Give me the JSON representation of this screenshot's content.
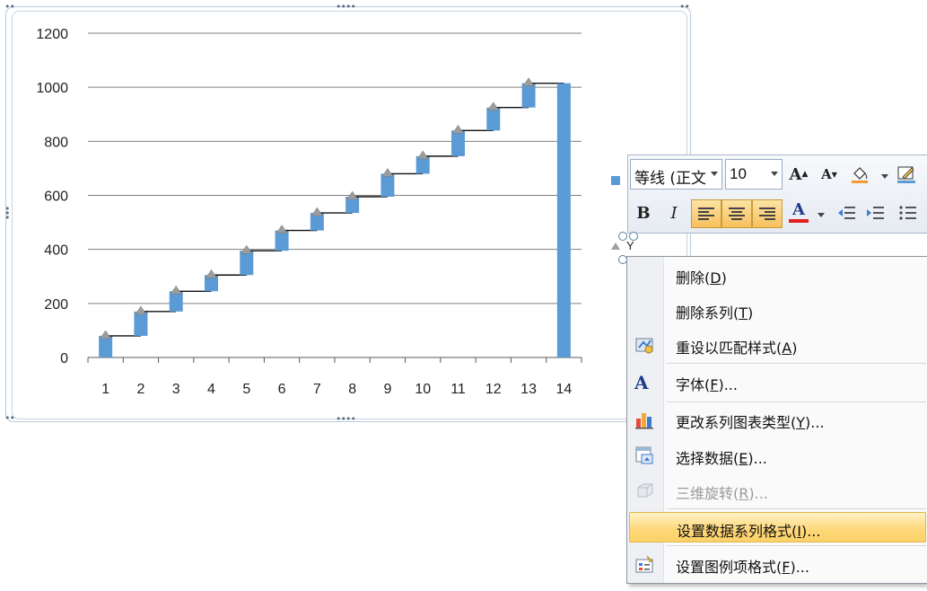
{
  "chart_data": {
    "type": "bar",
    "chart_style": "waterfall-step",
    "categories": [
      "1",
      "2",
      "3",
      "4",
      "5",
      "6",
      "7",
      "8",
      "9",
      "10",
      "11",
      "12",
      "13",
      "14"
    ],
    "series": [
      {
        "values": [
          80,
          170,
          245,
          305,
          395,
          470,
          535,
          595,
          680,
          745,
          840,
          925,
          1015,
          1015
        ],
        "color": "#5b9bd5"
      }
    ],
    "base_values": [
      0,
      80,
      170,
      245,
      305,
      395,
      470,
      535,
      595,
      680,
      745,
      840,
      925,
      0
    ],
    "ylim": [
      0,
      1200
    ],
    "yticks": [
      "0",
      "200",
      "400",
      "600",
      "800",
      "1000",
      "1200"
    ],
    "grid": true,
    "legend": "right"
  },
  "mini_toolbar": {
    "font_name": "等线 (正文",
    "font_size": "10",
    "bold_label": "B",
    "italic_label": "I",
    "font_color_label": "A",
    "grow_font_label": "A",
    "shrink_font_label": "A"
  },
  "axis_label_fragment": "Y",
  "context_menu": {
    "items": [
      {
        "text": "删除(",
        "key": "D",
        "tail": ")",
        "icon": "",
        "disabled": false
      },
      {
        "text": "删除系列(",
        "key": "T",
        "tail": ")",
        "icon": "",
        "disabled": false
      },
      {
        "text": "重设以匹配样式(",
        "key": "A",
        "tail": ")",
        "icon": "reset-style-icon",
        "disabled": false
      },
      {
        "text": "字体(",
        "key": "F",
        "tail": ")...",
        "icon": "font-icon",
        "disabled": false
      },
      {
        "text": "更改系列图表类型(",
        "key": "Y",
        "tail": ")...",
        "icon": "chart-type-icon",
        "disabled": false
      },
      {
        "text": "选择数据(",
        "key": "E",
        "tail": ")...",
        "icon": "select-data-icon",
        "disabled": false
      },
      {
        "text": "三维旋转(",
        "key": "R",
        "tail": ")...",
        "icon": "3d-rotation-icon",
        "disabled": true
      },
      {
        "text": "设置数据系列格式(",
        "key": "I",
        "tail": ")...",
        "icon": "",
        "disabled": false
      },
      {
        "text": "设置图例项格式(",
        "key": "F",
        "tail": ")...",
        "icon": "format-legend-icon",
        "disabled": false
      }
    ]
  },
  "colors": {
    "bar": "#5b9bd5",
    "grid": "#7f7f7f",
    "highlight": "#fed777"
  }
}
